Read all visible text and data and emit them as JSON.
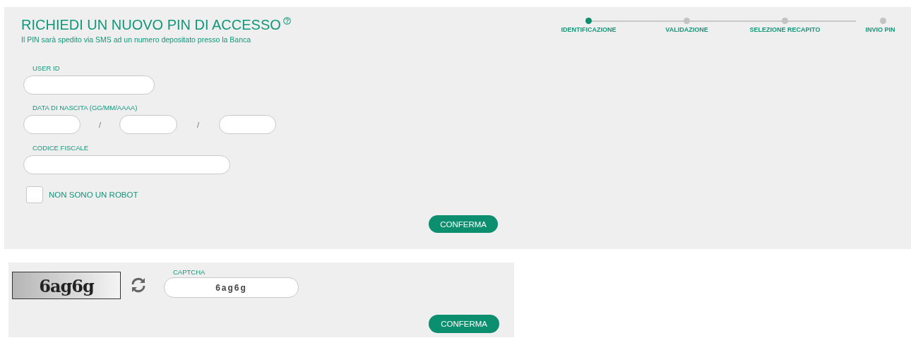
{
  "header": {
    "title": "RICHIEDI UN NUOVO PIN DI ACCESSO",
    "subtitle": "Il PIN sarà spedito via SMS ad un numero depositato presso la Banca"
  },
  "steps": [
    {
      "label": "IDENTIFICAZIONE",
      "selected": true
    },
    {
      "label": "VALIDAZIONE",
      "selected": false
    },
    {
      "label": "SELEZIONE RECAPITO",
      "selected": false
    },
    {
      "label": "INVIO PIN",
      "selected": false
    }
  ],
  "form": {
    "user_id_label": "USER ID",
    "birth_date_label": "DATA DI NASCITA (GG/MM/AAAA)",
    "date_separators": [
      "/",
      "/"
    ],
    "tax_code_label": "CODICE FISCALE",
    "robot_checkbox": {
      "label": "NON SONO UN ROBOT",
      "checked": false
    },
    "confirm_button": "CONFERMA"
  },
  "captcha": {
    "image_text": "6ag6g",
    "label": "CAPTCHA",
    "value": "6ag6g",
    "confirm_button": "CONFERMA"
  }
}
